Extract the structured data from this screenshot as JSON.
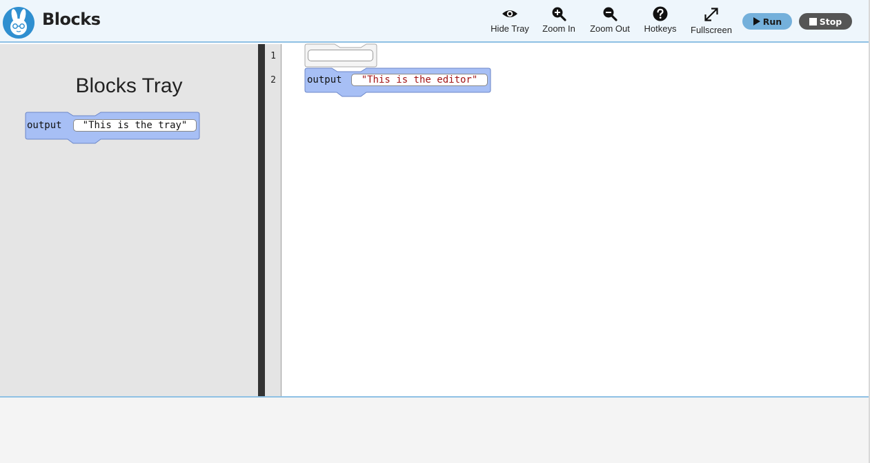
{
  "app": {
    "title": "Blocks"
  },
  "toolbar": {
    "hide_tray": "Hide Tray",
    "zoom_in": "Zoom In",
    "zoom_out": "Zoom Out",
    "hotkeys": "Hotkeys",
    "fullscreen": "Fullscreen",
    "run": "Run",
    "stop": "Stop"
  },
  "tray": {
    "title": "Blocks Tray",
    "block": {
      "keyword": "output",
      "value": "\"This is the tray\""
    }
  },
  "editor": {
    "line_numbers": [
      "1",
      "2"
    ],
    "block": {
      "keyword": "output",
      "value": "\"This is the editor\""
    }
  },
  "colors": {
    "header_bg": "#eef6fc",
    "accent_border": "#8ec0e4",
    "block_fill": "#a7bff5",
    "block_stroke": "#6b86c8",
    "run_button": "#74b0db",
    "stop_button": "#555555",
    "string_red": "#a31515"
  },
  "icons": {
    "logo": "bunny-logo-icon",
    "hide_tray": "eye-icon",
    "zoom_in": "zoom-in-icon",
    "zoom_out": "zoom-out-icon",
    "hotkeys": "question-circle-icon",
    "fullscreen": "expand-arrows-icon",
    "run": "play-icon",
    "stop": "stop-square-icon"
  }
}
